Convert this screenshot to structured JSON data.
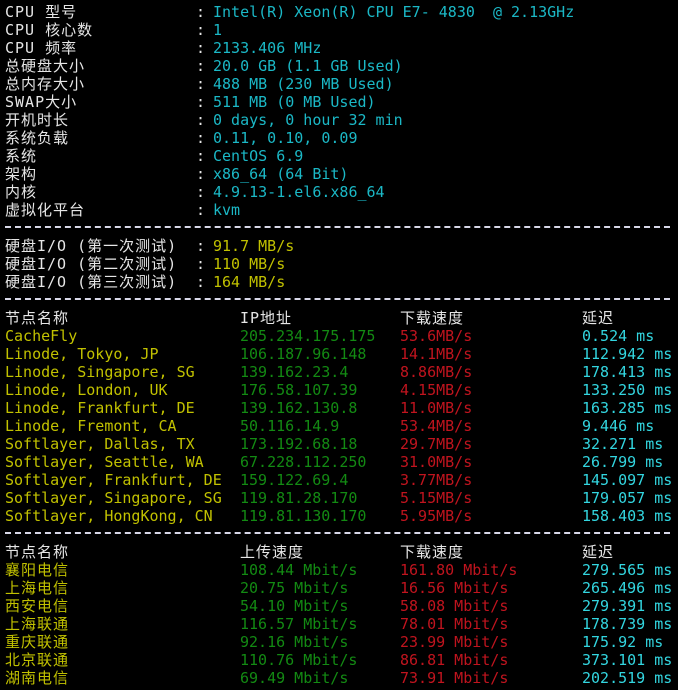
{
  "sysinfo": [
    {
      "label": "CPU 型号",
      "value": "Intel(R) Xeon(R) CPU E7- 4830  @ 2.13GHz"
    },
    {
      "label": "CPU 核心数",
      "value": "1"
    },
    {
      "label": "CPU 频率",
      "value": "2133.406 MHz"
    },
    {
      "label": "总硬盘大小",
      "value": "20.0 GB (1.1 GB Used)"
    },
    {
      "label": "总内存大小",
      "value": "488 MB (230 MB Used)"
    },
    {
      "label": "SWAP大小",
      "value": "511 MB (0 MB Used)"
    },
    {
      "label": "开机时长",
      "value": "0 days, 0 hour 32 min"
    },
    {
      "label": "系统负载",
      "value": "0.11, 0.10, 0.09"
    },
    {
      "label": "系统",
      "value": "CentOS 6.9"
    },
    {
      "label": "架构",
      "value": "x86_64 (64 Bit)"
    },
    {
      "label": "内核",
      "value": "4.9.13-1.el6.x86_64"
    },
    {
      "label": "虚拟化平台",
      "value": "kvm"
    }
  ],
  "colon": ":",
  "disk_io": [
    {
      "label": "硬盘I/O (第一次测试)",
      "value": "91.7 MB/s"
    },
    {
      "label": "硬盘I/O (第二次测试)",
      "value": "110 MB/s"
    },
    {
      "label": "硬盘I/O (第三次测试)",
      "value": "164 MB/s"
    }
  ],
  "intl_speed": {
    "headers": {
      "node": "节点名称",
      "ip": "IP地址",
      "download": "下载速度",
      "latency": "延迟"
    },
    "rows": [
      {
        "node": "CacheFly",
        "ip": "205.234.175.175",
        "download": "53.6MB/s",
        "latency": "0.524 ms"
      },
      {
        "node": "Linode, Tokyo, JP",
        "ip": "106.187.96.148",
        "download": "14.1MB/s",
        "latency": "112.942 ms"
      },
      {
        "node": "Linode, Singapore, SG",
        "ip": "139.162.23.4",
        "download": "8.86MB/s",
        "latency": "178.413 ms"
      },
      {
        "node": "Linode, London, UK",
        "ip": "176.58.107.39",
        "download": "4.15MB/s",
        "latency": "133.250 ms"
      },
      {
        "node": "Linode, Frankfurt, DE",
        "ip": "139.162.130.8",
        "download": "11.0MB/s",
        "latency": "163.285 ms"
      },
      {
        "node": "Linode, Fremont, CA",
        "ip": "50.116.14.9",
        "download": "53.4MB/s",
        "latency": "9.446 ms"
      },
      {
        "node": "Softlayer, Dallas, TX",
        "ip": "173.192.68.18",
        "download": "29.7MB/s",
        "latency": "32.271 ms"
      },
      {
        "node": "Softlayer, Seattle, WA",
        "ip": "67.228.112.250",
        "download": "31.0MB/s",
        "latency": "26.799 ms"
      },
      {
        "node": "Softlayer, Frankfurt, DE",
        "ip": "159.122.69.4",
        "download": "3.77MB/s",
        "latency": "145.097 ms"
      },
      {
        "node": "Softlayer, Singapore, SG",
        "ip": "119.81.28.170",
        "download": "5.15MB/s",
        "latency": "179.057 ms"
      },
      {
        "node": "Softlayer, HongKong, CN",
        "ip": "119.81.130.170",
        "download": "5.95MB/s",
        "latency": "158.403 ms"
      }
    ]
  },
  "cn_speed": {
    "headers": {
      "node": "节点名称",
      "upload": "上传速度",
      "download": "下载速度",
      "latency": "延迟"
    },
    "rows": [
      {
        "node": "襄阳电信",
        "upload": "108.44 Mbit/s",
        "download": "161.80 Mbit/s",
        "latency": "279.565 ms"
      },
      {
        "node": "上海电信",
        "upload": "20.75 Mbit/s",
        "download": "16.56 Mbit/s",
        "latency": "265.496 ms"
      },
      {
        "node": "西安电信",
        "upload": "54.10 Mbit/s",
        "download": "58.08 Mbit/s",
        "latency": "279.391 ms"
      },
      {
        "node": "上海联通",
        "upload": "116.57 Mbit/s",
        "download": "78.01 Mbit/s",
        "latency": "178.739 ms"
      },
      {
        "node": "重庆联通",
        "upload": "92.16 Mbit/s",
        "download": "23.99 Mbit/s",
        "latency": "175.92 ms"
      },
      {
        "node": "北京联通",
        "upload": "110.76 Mbit/s",
        "download": "86.81 Mbit/s",
        "latency": "373.101 ms"
      },
      {
        "node": "湖南电信",
        "upload": "69.49 Mbit/s",
        "download": "73.91 Mbit/s",
        "latency": "202.519 ms"
      }
    ]
  },
  "colors": {
    "label": "#e6e6e6",
    "sysinfo_value": "#1bb8c6",
    "disk_value": "#c1c100",
    "node": "#c1c100",
    "ip_upload": "#138a13",
    "download": "#c0141e",
    "latency": "#33d6e0"
  }
}
